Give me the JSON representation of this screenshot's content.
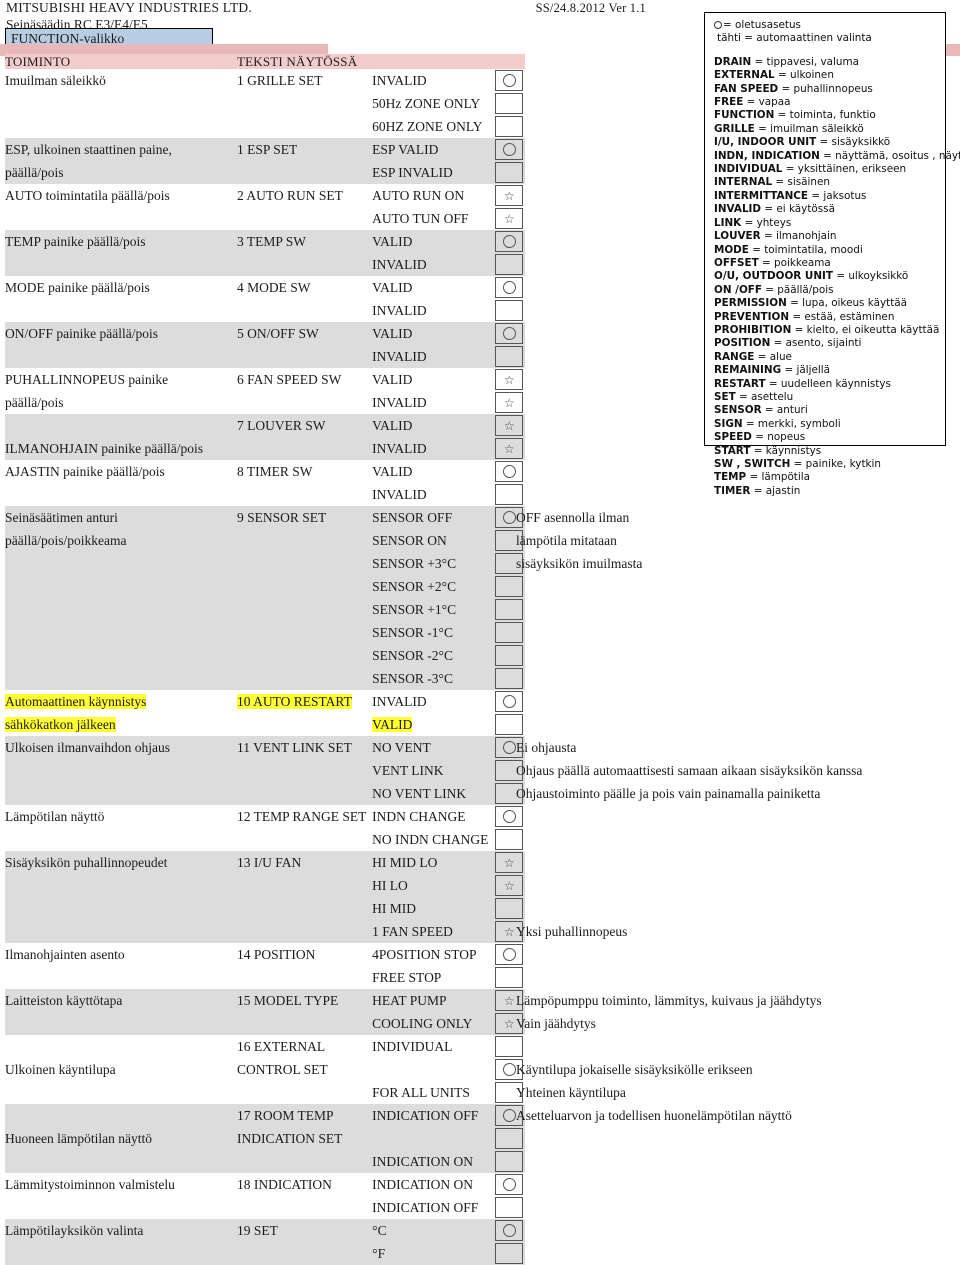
{
  "header": {
    "company": "MITSUBISHI HEAVY INDUSTRIES LTD.",
    "version": "SS/24.8.2012 Ver 1.1",
    "subtitle": "Seinäsäädin RC E3/E4/E5",
    "title_chip": "FUNCTION-valikko"
  },
  "table": {
    "columns": {
      "function": "TOIMINTO",
      "display": "TEKSTI NÄYTÖSSÄ"
    },
    "rows": [
      {
        "function": "Imuilman säleikkö",
        "display": "1 GRILLE SET",
        "value": "INVALID",
        "mark": "circle",
        "shaded": false,
        "note": ""
      },
      {
        "function": "",
        "display": "",
        "value": "50Hz ZONE ONLY",
        "mark": "",
        "shaded": false,
        "note": ""
      },
      {
        "function": "",
        "display": "",
        "value": "60HZ ZONE ONLY",
        "mark": "",
        "shaded": false,
        "note": ""
      },
      {
        "function": "ESP, ulkoinen staattinen paine,",
        "display": "1 ESP SET",
        "value": "ESP VALID",
        "mark": "circle",
        "shaded": true,
        "note": ""
      },
      {
        "function": "päällä/pois",
        "display": "",
        "value": "ESP INVALID",
        "mark": "",
        "shaded": true,
        "note": ""
      },
      {
        "function": "AUTO toimintatila päällä/pois",
        "display": "2 AUTO RUN SET",
        "value": "AUTO RUN ON",
        "mark": "star",
        "shaded": false,
        "note": ""
      },
      {
        "function": "",
        "display": "",
        "value": "AUTO TUN OFF",
        "mark": "star",
        "shaded": false,
        "note": ""
      },
      {
        "function": "TEMP painike päällä/pois",
        "display": "3 TEMP SW",
        "value": "VALID",
        "mark": "circle",
        "shaded": true,
        "note": ""
      },
      {
        "function": "",
        "display": "",
        "value": "INVALID",
        "mark": "",
        "shaded": true,
        "note": ""
      },
      {
        "function": "MODE painike päällä/pois",
        "display": "4 MODE SW",
        "value": "VALID",
        "mark": "circle",
        "shaded": false,
        "note": ""
      },
      {
        "function": "",
        "display": "",
        "value": "INVALID",
        "mark": "",
        "shaded": false,
        "note": ""
      },
      {
        "function": "ON/OFF painike päällä/pois",
        "display": "5 ON/OFF SW",
        "value": "VALID",
        "mark": "circle",
        "shaded": true,
        "note": ""
      },
      {
        "function": "",
        "display": "",
        "value": "INVALID",
        "mark": "",
        "shaded": true,
        "note": ""
      },
      {
        "function": "PUHALLINNOPEUS painike",
        "display": "6 FAN SPEED SW",
        "value": "VALID",
        "mark": "star",
        "shaded": false,
        "note": ""
      },
      {
        "function": "päällä/pois",
        "display": "",
        "value": "INVALID",
        "mark": "star",
        "shaded": false,
        "note": ""
      },
      {
        "function": "",
        "display": "7 LOUVER SW",
        "value": "VALID",
        "mark": "star",
        "shaded": true,
        "note": ""
      },
      {
        "function": "ILMANOHJAIN painike päällä/pois",
        "display": "",
        "value": "INVALID",
        "mark": "star",
        "shaded": true,
        "note": ""
      },
      {
        "function": "AJASTIN painike päällä/pois",
        "display": "8 TIMER SW",
        "value": "VALID",
        "mark": "circle",
        "shaded": false,
        "note": ""
      },
      {
        "function": "",
        "display": "",
        "value": "INVALID",
        "mark": "",
        "shaded": false,
        "note": ""
      },
      {
        "function": "Seinäsäätimen anturi",
        "display": "9 SENSOR SET",
        "value": "SENSOR OFF",
        "mark": "circle",
        "shaded": true,
        "note": "OFF asennolla ilman"
      },
      {
        "function": "päällä/pois/poikkeama",
        "display": "",
        "value": "SENSOR ON",
        "mark": "",
        "shaded": true,
        "note": "lämpötila mitataan"
      },
      {
        "function": "",
        "display": "",
        "value": "SENSOR +3°C",
        "mark": "",
        "shaded": true,
        "note": "sisäyksikön imuilmasta"
      },
      {
        "function": "",
        "display": "",
        "value": "SENSOR +2°C",
        "mark": "",
        "shaded": true,
        "note": ""
      },
      {
        "function": "",
        "display": "",
        "value": "SENSOR +1°C",
        "mark": "",
        "shaded": true,
        "note": ""
      },
      {
        "function": "",
        "display": "",
        "value": "SENSOR -1°C",
        "mark": "",
        "shaded": true,
        "note": ""
      },
      {
        "function": "",
        "display": "",
        "value": "SENSOR -2°C",
        "mark": "",
        "shaded": true,
        "note": ""
      },
      {
        "function": "",
        "display": "",
        "value": "SENSOR -3°C",
        "mark": "",
        "shaded": true,
        "note": ""
      },
      {
        "function": "Automaattinen käynnistys",
        "display": "10 AUTO RESTART",
        "value": "INVALID",
        "mark": "circle",
        "shaded": false,
        "note": "",
        "hl_function": true,
        "hl_display": true
      },
      {
        "function": "sähkökatkon jälkeen",
        "display": "",
        "value": "VALID",
        "mark": "",
        "shaded": false,
        "note": "",
        "hl_function": true,
        "hl_value": true
      },
      {
        "function": "Ulkoisen ilmanvaihdon ohjaus",
        "display": "11 VENT LINK SET",
        "value": "NO VENT",
        "mark": "circle",
        "shaded": true,
        "note": "Ei ohjausta"
      },
      {
        "function": "",
        "display": "",
        "value": "VENT LINK",
        "mark": "",
        "shaded": true,
        "note": "Ohjaus päällä automaattisesti samaan aikaan sisäyksikön kanssa"
      },
      {
        "function": "",
        "display": "",
        "value": "NO VENT LINK",
        "mark": "",
        "shaded": true,
        "note": "Ohjaustoiminto päälle ja pois vain painamalla painiketta"
      },
      {
        "function": "Lämpötilan näyttö",
        "display": "12 TEMP RANGE SET",
        "value": "INDN CHANGE",
        "mark": "circle",
        "shaded": false,
        "note": ""
      },
      {
        "function": "",
        "display": "",
        "value": "NO INDN CHANGE",
        "mark": "",
        "shaded": false,
        "note": ""
      },
      {
        "function": "Sisäyksikön puhallinnopeudet",
        "display": "13 I/U FAN",
        "value": "HI MID LO",
        "mark": "star",
        "shaded": true,
        "note": ""
      },
      {
        "function": "",
        "display": "",
        "value": "HI LO",
        "mark": "star",
        "shaded": true,
        "note": ""
      },
      {
        "function": "",
        "display": "",
        "value": "HI MID",
        "mark": "",
        "shaded": true,
        "note": ""
      },
      {
        "function": "",
        "display": "",
        "value": "1 FAN SPEED",
        "mark": "star",
        "shaded": true,
        "note": "Yksi puhallinnopeus"
      },
      {
        "function": "Ilmanohjainten asento",
        "display": "14 POSITION",
        "value": "4POSITION STOP",
        "mark": "circle",
        "shaded": false,
        "note": ""
      },
      {
        "function": "",
        "display": "",
        "value": "FREE STOP",
        "mark": "",
        "shaded": false,
        "note": ""
      },
      {
        "function": "Laitteiston käyttötapa",
        "display": "15 MODEL TYPE",
        "value": "HEAT PUMP",
        "mark": "star",
        "shaded": true,
        "note": "Lämpöpumppu toiminto, lämmitys, kuivaus ja jäähdytys"
      },
      {
        "function": "",
        "display": "",
        "value": "COOLING ONLY",
        "mark": "star",
        "shaded": true,
        "note": "Vain jäähdytys"
      },
      {
        "function": "",
        "display": "16 EXTERNAL",
        "value": "INDIVIDUAL",
        "mark": "",
        "shaded": false,
        "note": ""
      },
      {
        "function": "Ulkoinen käyntilupa",
        "display": "CONTROL SET",
        "value": "",
        "mark": "circle",
        "shaded": false,
        "note": "Käyntilupa jokaiselle sisäyksikölle erikseen"
      },
      {
        "function": "",
        "display": "",
        "value": "FOR ALL UNITS",
        "mark": "",
        "shaded": false,
        "note": "Yhteinen käyntilupa"
      },
      {
        "function": "",
        "display": "17 ROOM TEMP",
        "value": "INDICATION OFF",
        "mark": "circle",
        "shaded": true,
        "note": "Asetteluarvon ja todellisen huonelämpötilan näyttö"
      },
      {
        "function": "Huoneen lämpötilan näyttö",
        "display": "INDICATION SET",
        "value": "",
        "mark": "",
        "shaded": true,
        "note": ""
      },
      {
        "function": "",
        "display": "",
        "value": "INDICATION ON",
        "mark": "",
        "shaded": true,
        "note": ""
      },
      {
        "function": "Lämmitystoiminnon valmistelu",
        "display": "18 INDICATION",
        "value": "INDICATION ON",
        "mark": "circle",
        "shaded": false,
        "note": ""
      },
      {
        "function": "",
        "display": "",
        "value": "INDICATION OFF",
        "mark": "",
        "shaded": false,
        "note": ""
      },
      {
        "function": "Lämpötilayksikön valinta",
        "display": "19 SET",
        "value": "°C",
        "mark": "circle",
        "shaded": true,
        "note": ""
      },
      {
        "function": "",
        "display": "",
        "value": "°F",
        "mark": "",
        "shaded": true,
        "note": ""
      }
    ]
  },
  "legend": {
    "symbol_default": "= oletusasetus",
    "symbol_auto": "tähti = automaattinen valinta",
    "terms": [
      {
        "term": "DRAIN",
        "def": "= tippavesi, valuma"
      },
      {
        "term": "EXTERNAL",
        "def": "= ulkoinen"
      },
      {
        "term": "FAN SPEED",
        "def": "= puhallinnopeus"
      },
      {
        "term": "FREE",
        "def": "= vapaa"
      },
      {
        "term": "FUNCTION",
        "def": "= toiminta, funktio"
      },
      {
        "term": "GRILLE",
        "def": "= imuilman säleikkö"
      },
      {
        "term": "I/U, INDOOR UNIT",
        "def": "= sisäyksikkö"
      },
      {
        "term": "INDN, INDICATION",
        "def": "= näyttämä, osoitus , näyttää"
      },
      {
        "term": "INDIVIDUAL",
        "def": "= yksittäinen, erikseen"
      },
      {
        "term": "INTERNAL",
        "def": "= sisäinen"
      },
      {
        "term": "INTERMITTANCE",
        "def": "= jaksotus"
      },
      {
        "term": "INVALID",
        "def": "= ei käytössä"
      },
      {
        "term": "LINK",
        "def": "= yhteys"
      },
      {
        "term": "LOUVER",
        "def": "= ilmanohjain"
      },
      {
        "term": "MODE",
        "def": "= toimintatila, moodi"
      },
      {
        "term": "OFFSET",
        "def": "= poikkeama"
      },
      {
        "term": "O/U, OUTDOOR UNIT",
        "def": "= ulkoyksikkö"
      },
      {
        "term": "ON /OFF",
        "def": "= päällä/pois"
      },
      {
        "term": "PERMISSION",
        "def": "= lupa, oikeus käyttää"
      },
      {
        "term": "PREVENTION",
        "def": "= estää, estäminen"
      },
      {
        "term": "PROHIBITION",
        "def": "= kielto, ei  oikeutta käyttää"
      },
      {
        "term": "POSITION",
        "def": "= asento, sijainti"
      },
      {
        "term": "RANGE",
        "def": "= alue"
      },
      {
        "term": "REMAINING",
        "def": "= jäljellä"
      },
      {
        "term": "RESTART",
        "def": "= uudelleen käynnistys"
      },
      {
        "term": "SET",
        "def": "= asettelu"
      },
      {
        "term": "SENSOR",
        "def": "= anturi"
      },
      {
        "term": "SIGN",
        "def": "= merkki, symboli"
      },
      {
        "term": "SPEED",
        "def": "= nopeus"
      },
      {
        "term": "START",
        "def": "= käynnistys"
      },
      {
        "term": "SW , SWITCH",
        "def": "= painike, kytkin"
      },
      {
        "term": "TEMP",
        "def": "= lämpötila"
      },
      {
        "term": "TIMER",
        "def": "= ajastin"
      }
    ]
  },
  "colors": {
    "header_band": "#f2cdcc",
    "title_chip": "#b8cce4",
    "pink_bar": "#e8b9b8",
    "row_shade": "#dcdcdc",
    "highlight": "#ffff33"
  }
}
